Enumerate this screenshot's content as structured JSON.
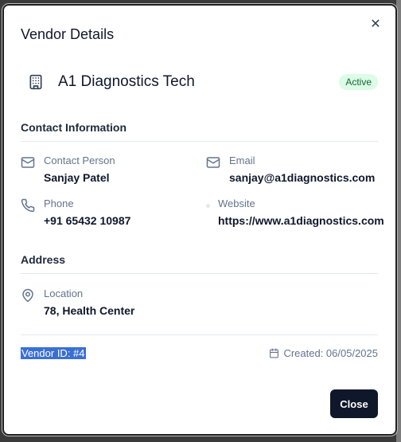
{
  "modal": {
    "title": "Vendor Details",
    "close_icon": "close-icon"
  },
  "vendor": {
    "name": "A1 Diagnostics Tech",
    "icon": "building-icon",
    "status": "Active",
    "status_color": "#dcfce7"
  },
  "contact": {
    "section_title": "Contact Information",
    "contact_person_label": "Contact Person",
    "contact_person_value": "Sanjay Patel",
    "email_label": "Email",
    "email_value": "sanjay@a1diagnostics.com",
    "phone_label": "Phone",
    "phone_value": "+91 65432 10987",
    "website_label": "Website",
    "website_value": "https://www.a1diagnostics.com"
  },
  "address": {
    "section_title": "Address",
    "location_label": "Location",
    "location_value": "78, Health Center"
  },
  "footer": {
    "vendor_id": "Vendor ID: #4",
    "created": "Created: 06/05/2025",
    "close_label": "Close"
  },
  "colors": {
    "primary": "#0f172a",
    "muted": "#64748b",
    "selection": "#3b6fd4"
  }
}
